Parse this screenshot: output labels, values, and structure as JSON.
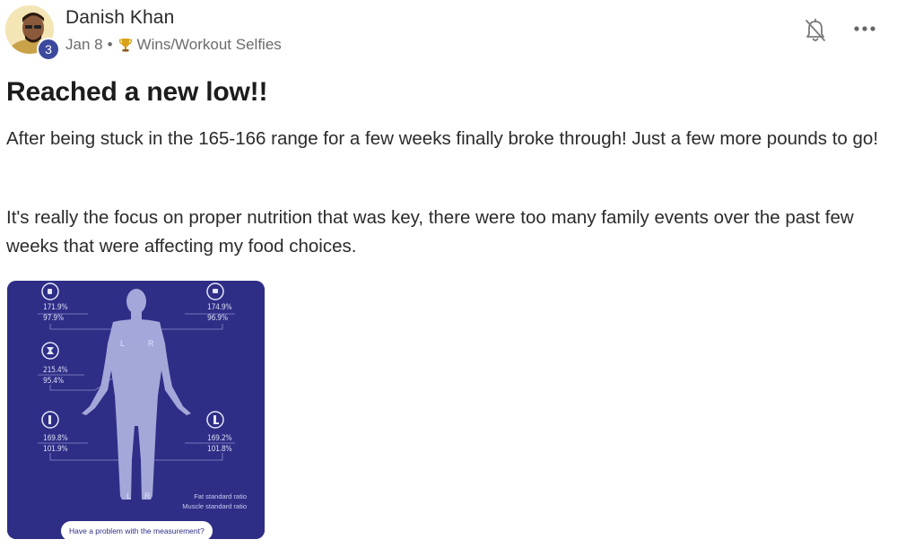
{
  "post": {
    "author": "Danish Khan",
    "level": "3",
    "date": "Jan 8",
    "separator": "•",
    "category": "Wins/Workout Selfies",
    "title": "Reached a new low!!",
    "paragraphs": [
      "After being stuck in the 165-166 range for a few weeks finally broke through! Just a few more pounds to go!",
      "It's really the focus on proper nutrition that was key, there were too many family events over the past few weeks that were affecting my food choices."
    ]
  },
  "image": {
    "stats": {
      "left_arm": [
        "171.9%",
        "97.9%"
      ],
      "right_arm": [
        "174.9%",
        "96.9%"
      ],
      "trunk": [
        "215.4%",
        "95.4%"
      ],
      "left_leg": [
        "169.8%",
        "101.9%"
      ],
      "right_leg": [
        "169.2%",
        "101.8%"
      ]
    },
    "side_labels": {
      "left": "L",
      "right": "R"
    },
    "legend": [
      "Fat standard ratio",
      "Muscle standard ratio"
    ],
    "problem_button": "Have a problem with the measurement?"
  },
  "icons": {
    "bell": "bell-off-icon",
    "more": "more-horizontal-icon",
    "trophy": "trophy-icon"
  },
  "colors": {
    "image_bg": "#2e2e86",
    "badge": "#3b4a9c"
  }
}
